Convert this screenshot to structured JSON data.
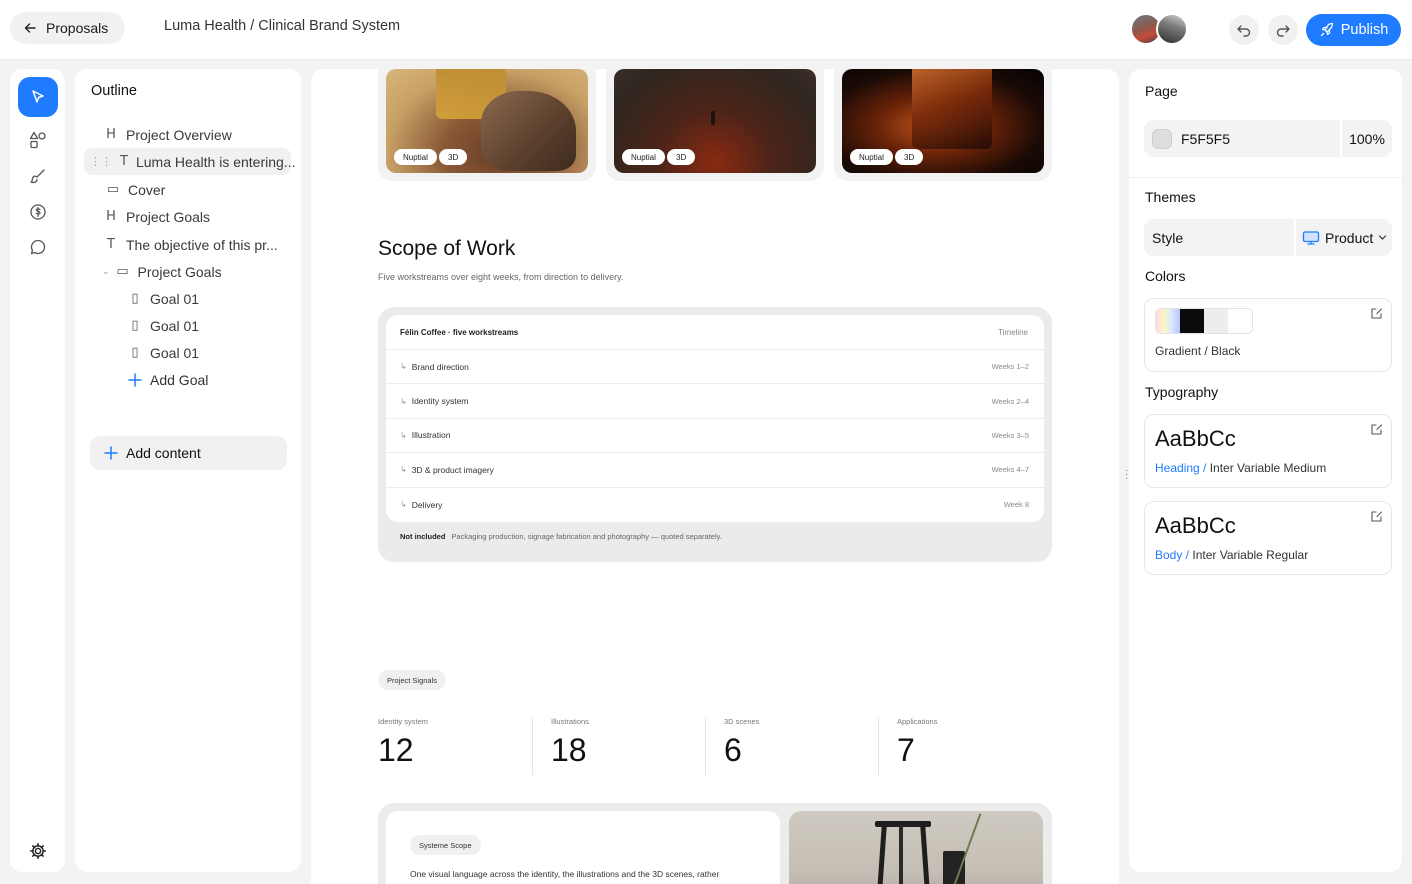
{
  "topbar": {
    "back_label": "Proposals",
    "breadcrumb": "Luma Health / Clinical Brand System",
    "publish_label": "Publish"
  },
  "rail": {
    "tools": [
      "cursor-icon",
      "shapes-icon",
      "brush-icon",
      "currency-icon",
      "comment-icon"
    ],
    "bottom_tool": "settings-icon",
    "accent": "#1f7bff"
  },
  "outline": {
    "title": "Outline",
    "items": [
      {
        "icon": "H",
        "label": "Project Overview"
      },
      {
        "icon": "T",
        "label": "Luma Health is entering..."
      },
      {
        "icon": "▭",
        "label": "Cover"
      },
      {
        "icon": "H",
        "label": "Project Goals"
      },
      {
        "icon": "T",
        "label": "The objective of this pr..."
      },
      {
        "icon": "▭",
        "label": "Project Goals"
      },
      {
        "icon": "▯",
        "label": "Goal 01"
      },
      {
        "icon": "▯",
        "label": "Goal 01"
      },
      {
        "icon": "▯",
        "label": "Goal 01"
      }
    ],
    "add_goal_label": "Add Goal",
    "add_content_label": "Add content"
  },
  "canvas": {
    "image_cards": [
      {
        "tag1": "Nuptial",
        "tag2": "3D"
      },
      {
        "tag1": "Nuptial",
        "tag2": "3D"
      },
      {
        "tag1": "Nuptial",
        "tag2": "3D"
      }
    ],
    "scope": {
      "title": "Scope of Work",
      "subtitle": "Five workstreams over eight weeks, from direction to delivery.",
      "table_title": "Félin Coffee · five workstreams",
      "table_col": "Timeline",
      "rows": [
        {
          "label": "Brand direction",
          "timeline": "Weeks 1–2"
        },
        {
          "label": "Identity system",
          "timeline": "Weeks 2–4"
        },
        {
          "label": "Illustration",
          "timeline": "Weeks 3–5"
        },
        {
          "label": "3D & product imagery",
          "timeline": "Weeks 4–7"
        },
        {
          "label": "Delivery",
          "timeline": "Week 8"
        }
      ],
      "footer_label": "Not included",
      "footer_text": "Packaging production, signage fabrication and photography — quoted separately."
    },
    "signals": {
      "pill": "Project Signals",
      "stats": [
        {
          "label": "Identity system",
          "value": "12"
        },
        {
          "label": "Illustrations",
          "value": "18"
        },
        {
          "label": "3D scenes",
          "value": "6"
        },
        {
          "label": "Applications",
          "value": "7"
        }
      ]
    },
    "systeme": {
      "pill": "Systeme Scope",
      "text": "One visual language across the identity, the illustrations and the 3D scenes, rather"
    }
  },
  "right_panel": {
    "page_title": "Page",
    "page_color": "F5F5F5",
    "page_opacity": "100%",
    "themes_title": "Themes",
    "style_label": "Style",
    "style_value": "Product",
    "colors_title": "Colors",
    "colors_caption": "Gradient / Black",
    "typography_title": "Typography",
    "heading_sample": "AaBbCc",
    "heading_role": "Heading /",
    "heading_font": " Inter Variable Medium",
    "body_sample": "AaBbCc",
    "body_role": "Body /",
    "body_font": " Inter Variable Regular",
    "role_color": "#1f7bff"
  }
}
